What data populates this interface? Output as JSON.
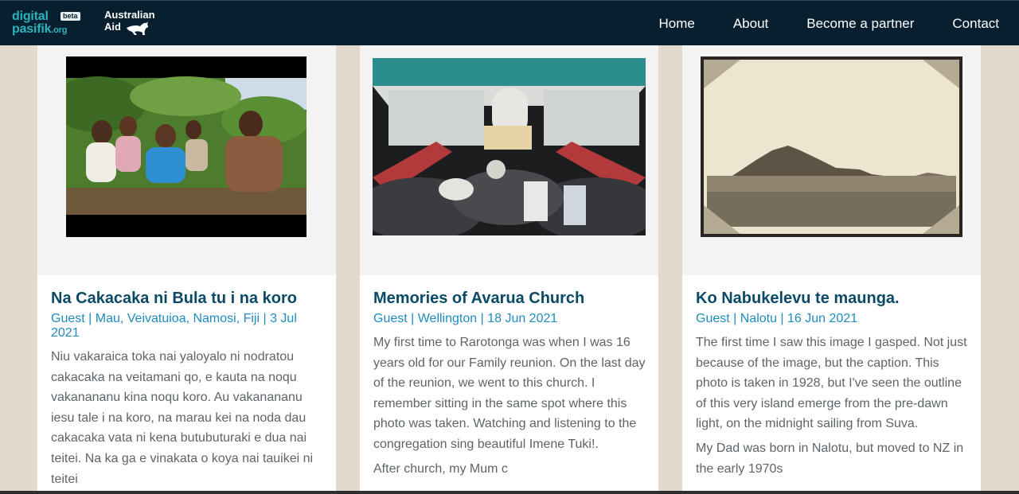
{
  "header": {
    "logo_line1": "digital",
    "logo_line2": "pasifik",
    "logo_org": ".org",
    "logo_badge": "beta",
    "partner_line1": "Australian",
    "partner_line2": "Aid",
    "nav": [
      "Home",
      "About",
      "Become a partner",
      "Contact"
    ]
  },
  "cards": [
    {
      "title": "Na Cakacaka ni Bula tu i na koro",
      "meta": "Guest | Mau, Veivatuioa, Namosi, Fiji | 3 Jul 2021",
      "excerpt": [
        "Niu vakaraica toka nai yaloyalo ni nodratou cakacaka na veitamani qo, e kauta na noqu vakanananu kina noqu koro. Au vakanananu iesu tale i na koro, na marau kei na noda dau cakacaka vata ni kena butubuturaki e dua nai teitei. Na ka ga e vinakata o koya nai tauikei ni teitei"
      ]
    },
    {
      "title": "Memories of Avarua Church",
      "meta": "Guest | Wellington | 18 Jun 2021",
      "excerpt": [
        "My first time to Rarotonga was when I was 16 years old for our Family reunion. On the last day of the reunion, we went to this church. I remember sitting in the same spot where this photo was taken. Watching and listening to the congregation sing beautiful Imene Tuki!.",
        "After church, my Mum c"
      ]
    },
    {
      "title": "Ko Nabukelevu te maunga.",
      "meta": "Guest | Nalotu | 16 Jun 2021",
      "excerpt": [
        "The first time I saw this image I gasped. Not just because of the image, but the caption. This photo is taken in 1928, but I've seen the outline of this very island emerge from the pre-dawn light, on the midnight sailing from Suva.",
        "My Dad was born in Nalotu, but moved to NZ in the early 1970s"
      ]
    }
  ]
}
